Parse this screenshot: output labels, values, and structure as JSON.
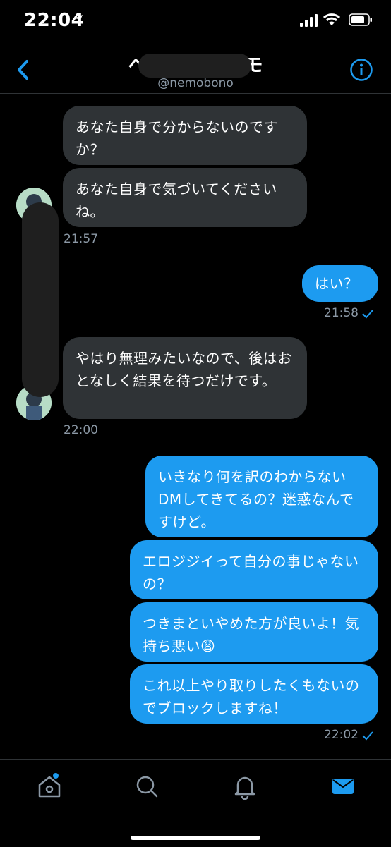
{
  "status": {
    "time": "22:04"
  },
  "header": {
    "title": "へなむ゙ー ーへモ",
    "handle": "@nemobono"
  },
  "messages": {
    "m1": "あなた自身で分からないのですか？",
    "m2": "あなた自身で気づいてくださいね。",
    "t1": "21:57",
    "m3": "はい？",
    "t2": "21:58",
    "m4": "やはり無理みたいなので、後はおとなしく結果を待つだけです。",
    "t3": "22:00",
    "m5": "いきなり何を訳のわからないDMしてきてるの？迷惑なんですけど。",
    "m6": "エロジジイって自分の事じゃないの？",
    "m7": "つきまといやめた方が良いよ！気持ち悪い😩",
    "m8": "これ以上やり取りしたくもないのでブロックしますね！",
    "t4": "22:02"
  },
  "icons": [
    "back-icon",
    "info-icon",
    "home-icon",
    "search-icon",
    "notifications-icon",
    "messages-icon"
  ],
  "colors": {
    "accent": "#1d9bf0",
    "incoming_bubble": "#2f3336",
    "background": "#000000"
  }
}
